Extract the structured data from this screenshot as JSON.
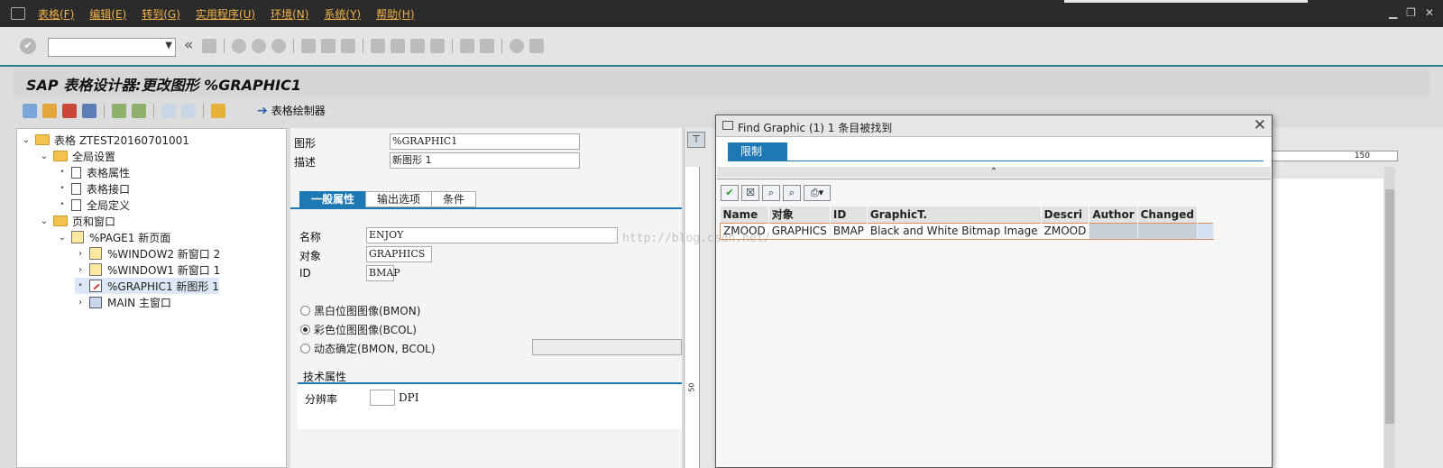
{
  "menu": [
    "表格(F)",
    "编辑(E)",
    "转到(G)",
    "实用程序(U)",
    "环境(N)",
    "系统(Y)",
    "帮助(H)"
  ],
  "title": "SAP 表格设计器:更改图形 %GRAPHIC1",
  "appbar": {
    "painter_label": "表格绘制器"
  },
  "tree": {
    "root": "表格 ZTEST20160701001",
    "global": "全局设置",
    "g1": "表格属性",
    "g2": "表格接口",
    "g3": "全局定义",
    "pages": "页和窗口",
    "page1": "%PAGE1 新页面",
    "win2": "%WINDOW2 新窗口 2",
    "win1": "%WINDOW1 新窗口 1",
    "graphic1": "%GRAPHIC1 新图形 1",
    "main": "MAIN 主窗口"
  },
  "attrs": {
    "graphic_label": "图形",
    "graphic_value": "%GRAPHIC1",
    "desc_label": "描述",
    "desc_value": "新图形 1",
    "tabs": [
      "一般属性",
      "输出选项",
      "条件"
    ],
    "name_label": "名称",
    "name_value": "ENJOY",
    "object_label": "对象",
    "object_value": "GRAPHICS",
    "id_label": "ID",
    "id_value": "BMAP",
    "radio1": "黑白位图图像(BMON)",
    "radio2": "彩色位图图像(BCOL)",
    "radio3": "动态确定(BMON, BCOL)",
    "tech_label": "技术属性",
    "res_label": "分辨率",
    "res_unit": "DPI"
  },
  "ruler": {
    "h_num": "150",
    "v_num": "50"
  },
  "dialog": {
    "caption": "Find Graphic (1)   1 条目被找到",
    "restrict_tab": "限制",
    "columns": [
      "Name",
      "对象",
      "ID",
      "GraphicT.",
      "Descri",
      "Author",
      "Changed"
    ],
    "row": [
      "ZMOOD",
      "GRAPHICS",
      "BMAP",
      "Black and White Bitmap Image",
      "ZMOOD",
      "",
      ""
    ]
  },
  "watermark": "http://blog.csdn.net/"
}
